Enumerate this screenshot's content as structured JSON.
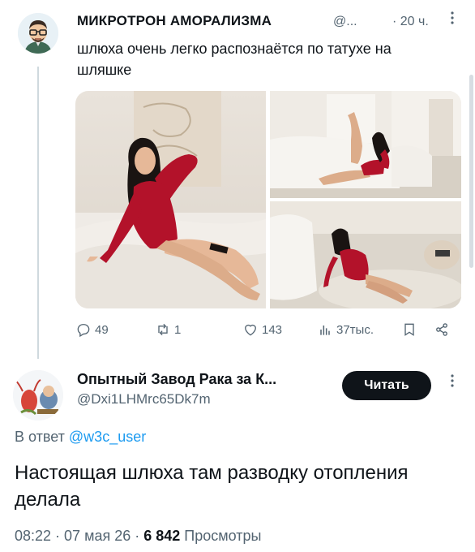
{
  "tweet1": {
    "display_name": "МИКРОТРОН АМОРАЛИЗМА",
    "handle": "@...",
    "time": "· 20 ч.",
    "more_icon": "more-dots-icon",
    "text": "шлюха очень легко распознаётся по татухе на шляшке",
    "media": [
      {
        "name": "photo-main"
      },
      {
        "name": "photo-top-right"
      },
      {
        "name": "photo-bottom-right"
      }
    ],
    "actions": {
      "reply_count": "49",
      "retweet_count": "1",
      "like_count": "143",
      "views_count": "37тыс."
    }
  },
  "tweet2": {
    "display_name": "Опытный Завод Рака за К...",
    "handle": "@Dxi1LHMrc65Dk7m",
    "follow_label": "Читать",
    "reply_prefix": "В ответ",
    "reply_mention": "@w3c_user",
    "text": "Настоящая шлюха там разводку отопления делала",
    "time": "08:22 · 07 мая 26 ·",
    "views_count": "6 842",
    "views_label": "Просмотры"
  },
  "colors": {
    "text_primary": "#0f1419",
    "text_secondary": "#536471",
    "link": "#1d9bf0",
    "button_bg": "#0f1419",
    "thread_line": "#cfd9de",
    "lingerie_red": "#b3122a"
  }
}
